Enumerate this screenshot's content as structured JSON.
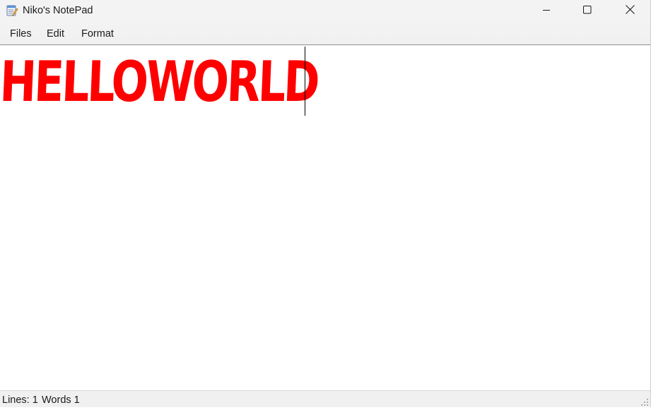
{
  "window": {
    "title": "Niko's NotePad",
    "app_icon": "notepad-icon"
  },
  "caption_buttons": {
    "minimize_icon": "minimize-icon",
    "maximize_icon": "maximize-icon",
    "close_icon": "close-icon"
  },
  "menu": {
    "items": [
      {
        "label": "Files"
      },
      {
        "label": "Edit"
      },
      {
        "label": "Format"
      }
    ]
  },
  "editor": {
    "text": "HELLOWORLD",
    "text_color": "#ff0000",
    "font_style": "distressed-bold"
  },
  "status": {
    "lines": "Lines: 1",
    "words": "Words 1"
  }
}
